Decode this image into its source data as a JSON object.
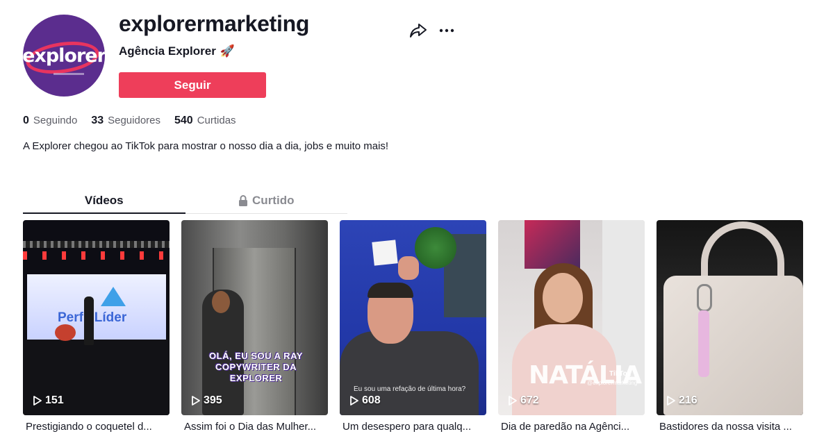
{
  "profile": {
    "username": "explorermarketing",
    "display_name": "Agência Explorer",
    "display_emoji": "🚀",
    "avatar_text": "explorer",
    "follow_label": "Seguir",
    "stats": [
      {
        "value": "0",
        "label": "Seguindo"
      },
      {
        "value": "33",
        "label": "Seguidores"
      },
      {
        "value": "540",
        "label": "Curtidas"
      }
    ],
    "bio": "A Explorer chegou ao TikTok para mostrar o nosso dia a dia, jobs e muito mais!"
  },
  "tabs": [
    {
      "label": "Vídeos",
      "active": true
    },
    {
      "label": "Curtido",
      "active": false,
      "icon": "lock-icon"
    }
  ],
  "videos": [
    {
      "views": "151",
      "caption": "Prestigiando o coquetel d...",
      "overlay": "Perfil Líder"
    },
    {
      "views": "395",
      "caption": "Assim foi o Dia das Mulher...",
      "overlay": "OLÁ, EU SOU A RAY COPYWRITER DA EXPLORER"
    },
    {
      "views": "608",
      "caption": "Um desespero para qualq...",
      "overlay": "Eu sou uma refação de última hora?"
    },
    {
      "views": "672",
      "caption": "Dia de paredão na Agênci...",
      "overlay": "NATÁLIA",
      "watermark": "TikTok",
      "handle": "@explorermarketing"
    },
    {
      "views": "216",
      "caption": "Bastidores da nossa visita ..."
    }
  ],
  "colors": {
    "accent": "#ee3e5a",
    "avatar_bg": "#5b2d8e",
    "text": "#161823",
    "muted": "#8a8b91"
  }
}
